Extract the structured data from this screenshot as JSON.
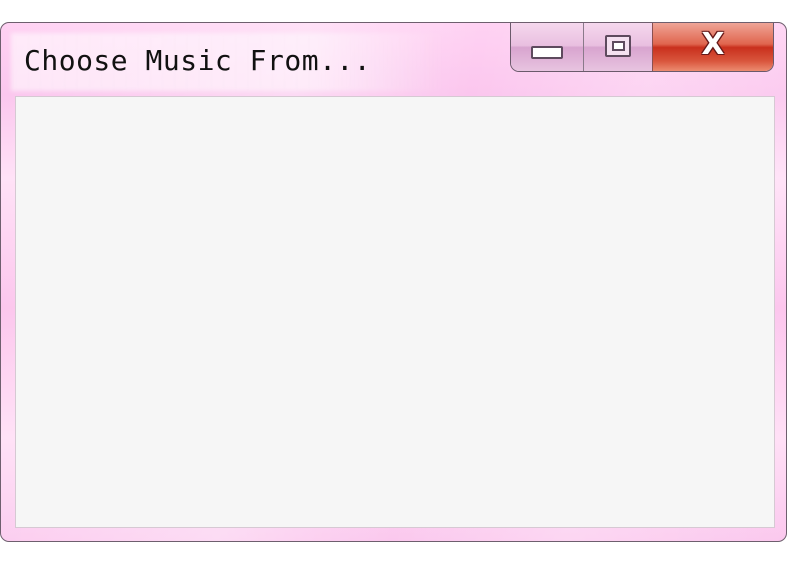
{
  "window": {
    "title": "Choose Music From...",
    "controls": {
      "minimize_icon": "minimize-icon",
      "maximize_icon": "maximize-icon",
      "close_icon": "close-icon",
      "close_glyph": "X"
    }
  },
  "colors": {
    "frame": "#fbc6ee",
    "content_background": "#f6f6f6",
    "close_button": "#d9412a"
  }
}
